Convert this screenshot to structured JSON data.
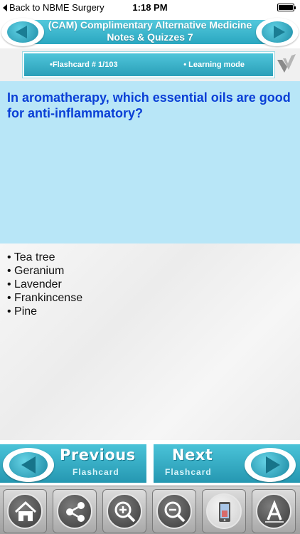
{
  "status_bar": {
    "back_label": "Back to NBME Surgery",
    "time": "1:18 PM"
  },
  "header": {
    "title_line1": "(CAM) Complimentary Alternative Medicine",
    "title_line2": "Notes & Quizzes 7"
  },
  "info_bar": {
    "flashcard_label": "•Flashcard #  1/103",
    "mode_label": "• Learning mode"
  },
  "question": {
    "text": "In aromatherapy, which essential oils are good for anti-inflammatory?"
  },
  "answer": {
    "items": [
      "Tea tree",
      "Geranium",
      "Lavender",
      "Frankincense",
      "Pine"
    ]
  },
  "bottom_nav": {
    "previous_title": "Previous",
    "previous_sub": "Flashcard",
    "next_title": "Next",
    "next_sub": "Flashcard"
  },
  "toolbar": {
    "icons": [
      "home-icon",
      "share-icon",
      "zoom-in-icon",
      "zoom-out-icon",
      "phone-image-icon",
      "font-icon"
    ]
  },
  "colors": {
    "accent": "#2aa7c0",
    "question_bg": "#b8e6f7",
    "question_text": "#0a3fd6"
  }
}
